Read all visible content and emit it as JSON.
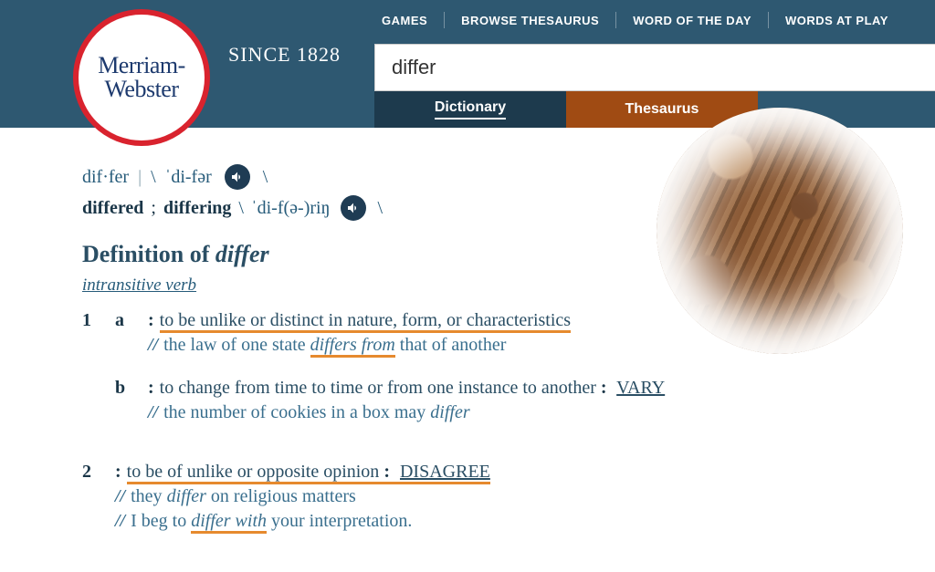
{
  "brand": {
    "line1": "Merriam-",
    "line2": "Webster",
    "since": "SINCE 1828"
  },
  "topnav": {
    "games": "GAMES",
    "browse": "BROWSE THESAURUS",
    "wotd": "WORD OF THE DAY",
    "wap": "WORDS AT PLAY"
  },
  "search": {
    "value": "differ"
  },
  "tabs": {
    "dictionary": "Dictionary",
    "thesaurus": "Thesaurus"
  },
  "entry": {
    "syllables": "dif·fer",
    "pron1": "ˈdi-fər",
    "form1": "differed",
    "form_sep": ";",
    "form2": "differing",
    "pron2": "ˈdi-f(ə-)riŋ",
    "def_head_prefix": "Definition of ",
    "def_head_word": "differ",
    "pos": "intransitive verb",
    "s1a_def": "to be unlike or distinct in nature, form, or characteristics",
    "s1a_ex_pre": "the law of one state ",
    "s1a_ex_hi": "differs from",
    "s1a_ex_post": " that of another",
    "s1b_def": "to change from time to time or from one instance to another ",
    "s1b_syn": "VARY",
    "s1b_ex_pre": "the number of cookies in a box may ",
    "s1b_ex_it": "differ",
    "s2_def": "to be of unlike or opposite opinion ",
    "s2_syn": "DISAGREE",
    "s2_ex1_pre": "they ",
    "s2_ex1_it": "differ",
    "s2_ex1_post": " on religious matters",
    "s2_ex2_pre": "I beg to ",
    "s2_ex2_hi": "differ with",
    "s2_ex2_post": " your interpretation."
  },
  "labels": {
    "n1": "1",
    "la": "a",
    "lb": "b",
    "n2": "2",
    "colon": ":",
    "slashes": "//",
    "backslash": "\\",
    "pipe": "|"
  }
}
